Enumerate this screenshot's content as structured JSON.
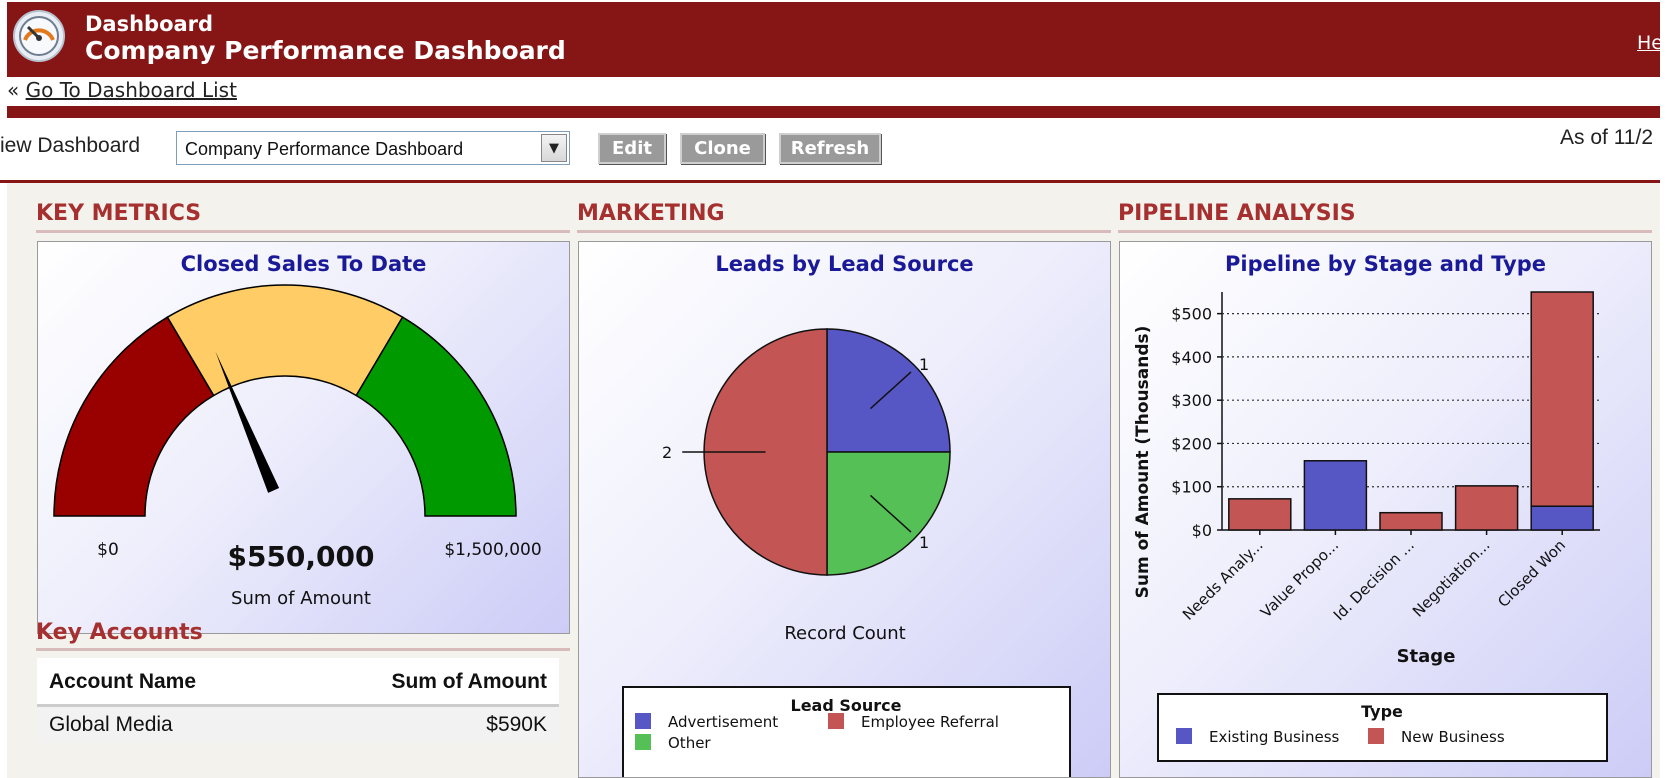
{
  "header": {
    "small_title": "Dashboard",
    "big_title": "Company Performance Dashboard",
    "help_link": "He",
    "logo_icon": "gauge-logo-icon"
  },
  "nav": {
    "back_prefix": "«",
    "back_label": "Go To Dashboard List"
  },
  "toolbar": {
    "view_label": "iew Dashboard",
    "selected_dashboard": "Company Performance Dashboard",
    "edit_label": "Edit",
    "clone_label": "Clone",
    "refresh_label": "Refresh",
    "as_of": "As of 11/2"
  },
  "sections": {
    "key_metrics": "KEY METRICS",
    "marketing": "MARKETING",
    "pipeline": "PIPELINE ANALYSIS",
    "key_accounts": "Key Accounts"
  },
  "gauge": {
    "title": "Closed Sales To Date",
    "min_label": "$0",
    "max_label": "$1,500,000",
    "value_label": "$550,000",
    "metric_label": "Sum of Amount",
    "min": 0,
    "max": 1500000,
    "value": 550000,
    "bands": [
      {
        "from": 0,
        "to": 0.33,
        "color": "#990000"
      },
      {
        "from": 0.33,
        "to": 0.67,
        "color": "#ffcc66"
      },
      {
        "from": 0.67,
        "to": 1,
        "color": "#009900"
      }
    ]
  },
  "pie": {
    "title": "Leads by Lead Source",
    "footer": "Record Count",
    "legend_title": "Lead Source",
    "slices": [
      {
        "name": "Advertisement",
        "value": 1,
        "label": "1",
        "color": "#5656c4"
      },
      {
        "name": "Other",
        "value": 1,
        "label": "1",
        "color": "#55c055"
      },
      {
        "name": "Employee Referral",
        "value": 2,
        "label": "2",
        "color": "#c35555"
      }
    ],
    "legend": [
      {
        "name": "Advertisement",
        "color": "#5656c4"
      },
      {
        "name": "Employee Referral",
        "color": "#c35555"
      },
      {
        "name": "Other",
        "color": "#55c055"
      }
    ]
  },
  "chart_data": {
    "type": "bar",
    "title": "Pipeline by Stage and Type",
    "xlabel": "Stage",
    "ylabel": "Sum of Amount (Thousands)",
    "categories": [
      "Needs Analy...",
      "Value Propo...",
      "Id. Decision ...",
      "Negotiation...",
      "Closed Won"
    ],
    "series": [
      {
        "name": "Existing Business",
        "color": "#5656c4",
        "values": [
          0,
          160,
          0,
          0,
          55
        ]
      },
      {
        "name": "New Business",
        "color": "#c35555",
        "values": [
          72,
          0,
          40,
          102,
          495
        ]
      }
    ],
    "stacked": true,
    "ylim": [
      0,
      500
    ],
    "yticks": [
      0,
      100,
      200,
      300,
      400,
      500
    ],
    "ytick_labels": [
      "$0",
      "$100",
      "$200",
      "$300",
      "$400",
      "$500"
    ],
    "grid": true,
    "legend_title": "Type",
    "legend_position": "bottom"
  },
  "accounts_table": {
    "columns": [
      "Account Name",
      "Sum of Amount"
    ],
    "rows": [
      [
        "Global Media",
        "$590K"
      ]
    ]
  }
}
